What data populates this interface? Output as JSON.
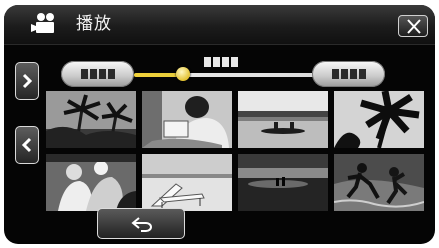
{
  "header": {
    "title": "播放",
    "mode_icon": "movie-camera-icon",
    "close_icon": "close-icon"
  },
  "timeline": {
    "prev_date_icon": "prev-date-button",
    "next_date_icon": "next-date-button",
    "selected_position": 0.28
  },
  "navigation": {
    "next_page_icon": "chevron-right-icon",
    "prev_page_icon": "chevron-left-icon",
    "back_icon": "return-arrow-icon"
  },
  "thumbnails": [
    {
      "scene": "palm-trees"
    },
    {
      "scene": "woman-reading"
    },
    {
      "scene": "canoe-on-water"
    },
    {
      "scene": "palm-leaves"
    },
    {
      "scene": "people-crowd"
    },
    {
      "scene": "beach-chair"
    },
    {
      "scene": "sunset-couple"
    },
    {
      "scene": "running-at-beach"
    }
  ],
  "colors": {
    "accent": "#e6cc3b",
    "background": "#050505",
    "button_border": "#d9d9d9"
  }
}
